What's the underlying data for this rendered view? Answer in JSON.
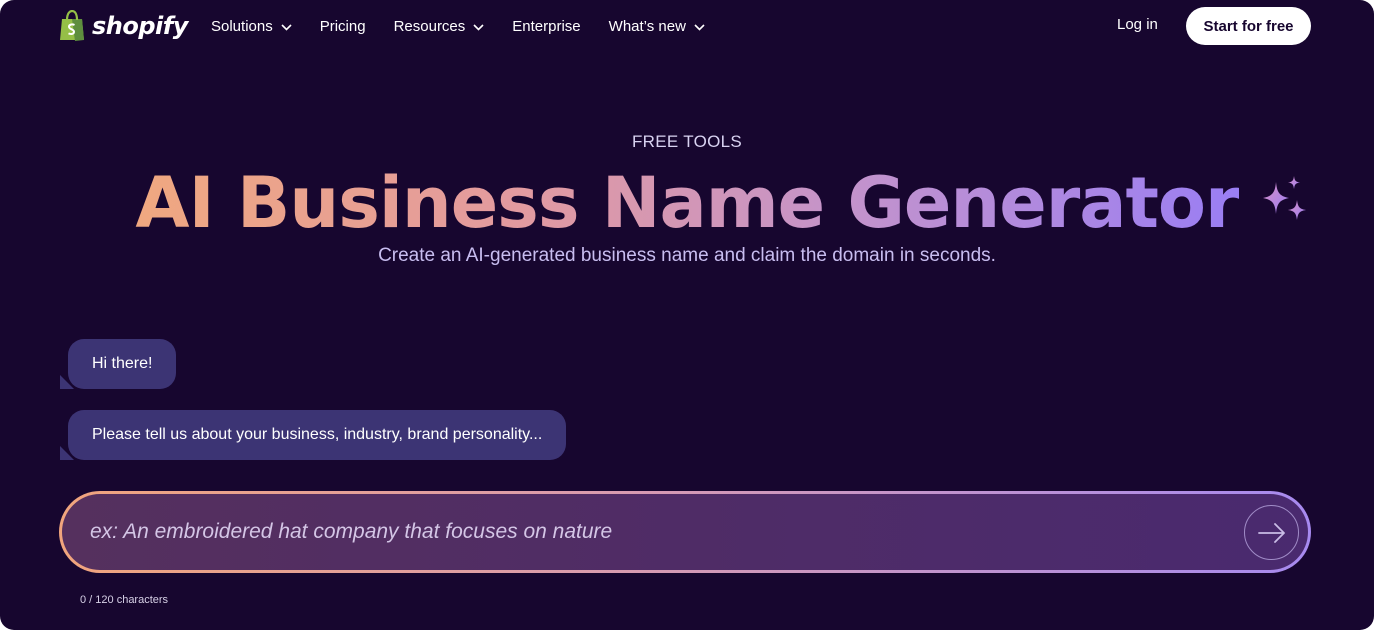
{
  "header": {
    "logo_text": "shopify",
    "nav": [
      {
        "label": "Solutions",
        "has_dropdown": true
      },
      {
        "label": "Pricing",
        "has_dropdown": false
      },
      {
        "label": "Resources",
        "has_dropdown": true
      },
      {
        "label": "Enterprise",
        "has_dropdown": false
      },
      {
        "label": "What’s new",
        "has_dropdown": true
      }
    ],
    "login_label": "Log in",
    "start_label": "Start for free"
  },
  "hero": {
    "eyebrow": "FREE TOOLS",
    "title": "AI Business Name Generator",
    "subtitle": "Create an AI-generated business name and claim the domain in seconds."
  },
  "chat": {
    "messages": [
      "Hi there!",
      "Please tell us about your business, industry, brand personality..."
    ]
  },
  "prompt": {
    "value": "",
    "placeholder": "ex: An embroidered hat company that focuses on nature",
    "char_count": "0 / 120 characters"
  },
  "icons": {
    "logo": "shopping-bag-icon",
    "dropdown": "chevron-down-icon",
    "title_decoration": "sparkle-icon",
    "submit": "arrow-right-icon"
  },
  "colors": {
    "background": "#17062f",
    "bubble": "#3c3474",
    "brand_green": "#95bf47",
    "gradient_start": "#f0a880",
    "gradient_end": "#9a7ef4"
  }
}
